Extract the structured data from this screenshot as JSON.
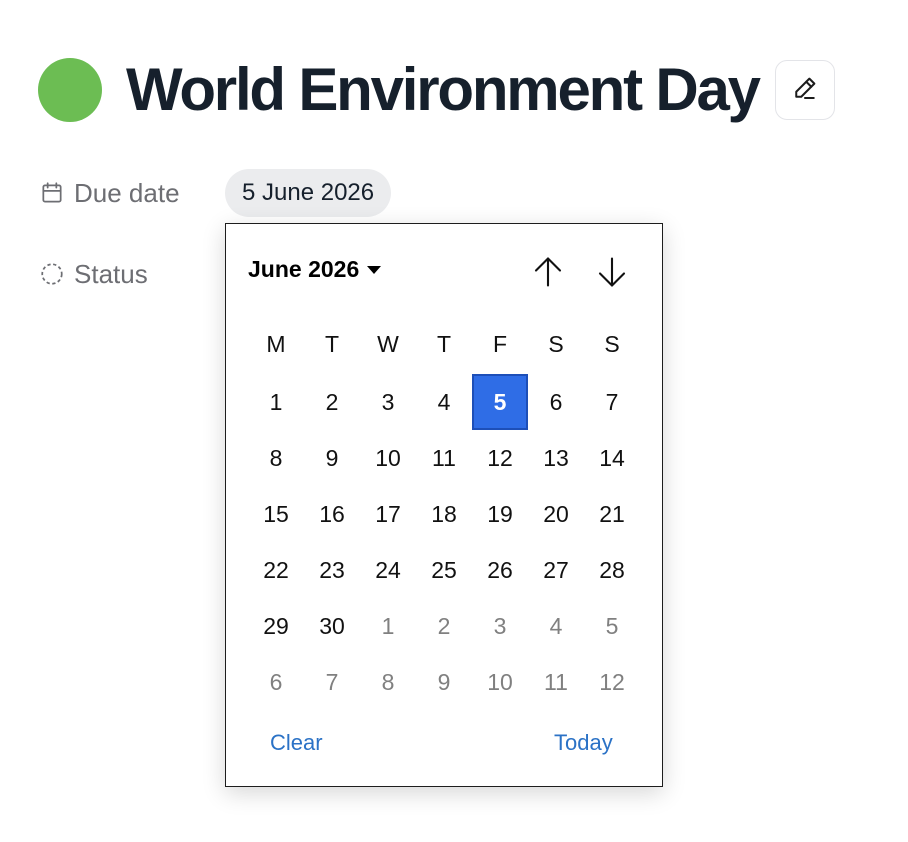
{
  "colors": {
    "status_dot": "#6cbd53",
    "selected_day": "#2f6de6",
    "link": "#2b72c6"
  },
  "page": {
    "title": "World Environment Day"
  },
  "icons": {
    "edit": "pencil-icon",
    "calendar": "calendar-icon",
    "status": "dashed-circle-icon"
  },
  "properties": {
    "due_date": {
      "label": "Due date",
      "value": "5 June 2026"
    },
    "status": {
      "label": "Status"
    }
  },
  "datepicker": {
    "month_label": "June 2026",
    "weekdays": [
      "M",
      "T",
      "W",
      "T",
      "F",
      "S",
      "S"
    ],
    "weeks": [
      [
        "1",
        "2",
        "3",
        "4",
        "5",
        "6",
        "7"
      ],
      [
        "8",
        "9",
        "10",
        "11",
        "12",
        "13",
        "14"
      ],
      [
        "15",
        "16",
        "17",
        "18",
        "19",
        "20",
        "21"
      ],
      [
        "22",
        "23",
        "24",
        "25",
        "26",
        "27",
        "28"
      ],
      [
        "29",
        "30",
        "1",
        "2",
        "3",
        "4",
        "5"
      ],
      [
        "6",
        "7",
        "8",
        "9",
        "10",
        "11",
        "12"
      ]
    ],
    "other_month": [
      [
        false,
        false,
        false,
        false,
        false,
        false,
        false
      ],
      [
        false,
        false,
        false,
        false,
        false,
        false,
        false
      ],
      [
        false,
        false,
        false,
        false,
        false,
        false,
        false
      ],
      [
        false,
        false,
        false,
        false,
        false,
        false,
        false
      ],
      [
        false,
        false,
        true,
        true,
        true,
        true,
        true
      ],
      [
        true,
        true,
        true,
        true,
        true,
        true,
        true
      ]
    ],
    "selected": "5",
    "clear_label": "Clear",
    "today_label": "Today"
  }
}
